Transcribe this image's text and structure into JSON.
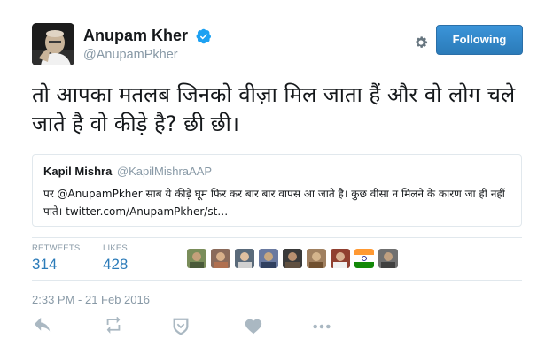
{
  "user": {
    "display_name": "Anupam Kher",
    "handle": "@AnupamPkher",
    "verified_icon": "verified-badge-icon",
    "avatar_icon": "avatar-photo"
  },
  "actions_top": {
    "settings_icon": "gear-icon",
    "follow_label": "Following"
  },
  "tweet": {
    "text": "तो आपका मतलब जिनको वीज़ा मिल जाता हैं और वो लोग चले जाते है वो कीड़े है? छी छी।"
  },
  "quoted_tweet": {
    "name": "Kapil Mishra",
    "handle": "@KapilMishraAAP",
    "text": "पर @AnupamPkher साब ये कीड़े घूम फिर कर बार बार वापस आ जाते है। कुछ वीसा न मिलने के कारण जा ही नहीं पाते। twitter.com/AnupamPkher/st…"
  },
  "stats": {
    "retweets_label": "RETWEETS",
    "retweets_value": "314",
    "likes_label": "LIKES",
    "likes_value": "428"
  },
  "likers": [
    "liker-avatar-1",
    "liker-avatar-2",
    "liker-avatar-3",
    "liker-avatar-4",
    "liker-avatar-5",
    "liker-avatar-6",
    "liker-avatar-7",
    "liker-avatar-8",
    "liker-avatar-9"
  ],
  "timestamp": "2:33 PM - 21 Feb 2016",
  "tweet_actions": [
    "reply-icon",
    "retweet-icon",
    "save-icon",
    "like-icon",
    "more-icon"
  ],
  "colors": {
    "link_blue": "#2b7bb9",
    "follow_button": "#3b94d9",
    "muted_text": "#8899a6",
    "border": "#e1e8ed"
  }
}
